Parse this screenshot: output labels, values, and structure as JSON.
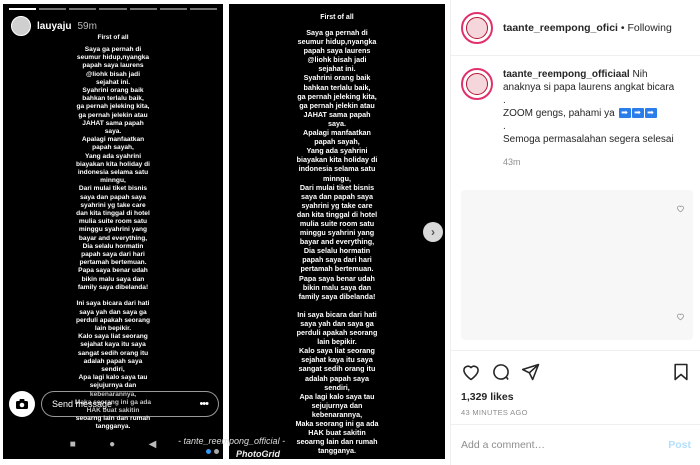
{
  "story_left": {
    "username": "lauyaju",
    "time": "59m",
    "title": "First of all",
    "text": "Saya ga pernah di\nseumur hidup,nyangka\npapah saya laurens\n@liohk bisah jadi\nsejahat ini.\nSyahrini orang baik\nbahkan terlalu baik,\nga pernah jeleking kita,\nga pernah jelekin atau\nJAHAT sama papah\nsaya.\nApalagi manfaatkan\npapah sayah,\nYang ada syahrini\nbiayakan kita holiday di\nindonesia selama satu\nminngu,\nDari mulai tiket bisnis\nsaya dan papah saya\nsyahrini yg take care\ndan kita tinggal di hotel\nmulia suite room satu\nminggu syahrini yang\nbayar and everything,\nDia selalu hormatin\npapah saya dari hari\npertamah bertemuan.\nPapa saya benar udah\nbikin malu saya dan\nfamily saya dibelanda!\n\nIni saya bicara dari hati\nsaya yah dan saya ga\nperduli apakah seorang\nlain bepikir.\nKalo saya liat seorang\nsejahat kaya itu saya\nsangat sedih orang itu\nadalah papah saya\nsendiri,\nApa lagi kalo saya tau\nsejujurnya dan\nkebenarannya,\nMaka seorang ini ga ada\nHAK buat sakitin\nseoarng lain dan rumah\ntangganya.",
    "send_placeholder": "Send message",
    "menu_dots": "•••",
    "nav_square": "■",
    "nav_circle": "●",
    "nav_back": "◀"
  },
  "story_right": {
    "title": "First of all",
    "text": "Saya ga pernah di\nseumur hidup,nyangka\npapah saya laurens\n@liohk bisah jadi\nsejahat ini.\nSyahrini orang baik\nbahkan terlalu baik,\nga pernah jeleking kita,\nga pernah jelekin atau\nJAHAT sama papah\nsaya.\nApalagi manfaatkan\npapah sayah,\nYang ada syahrini\nbiayakan kita holiday di\nindonesia selama satu\nminngu,\nDari mulai tiket bisnis\nsaya dan papah saya\nsyahrini yg take care\ndan kita tinggal di hotel\nmulia suite room satu\nminggu syahrini yang\nbayar and everything,\nDia selalu hormatin\npapah saya dari hari\npertamah bertemuan.\nPapa saya benar udah\nbikin malu saya dan\nfamily saya dibelanda!\n\nIni saya bicara dari hati\nsaya yah dan saya ga\nperduli apakah seorang\nlain bepikir.\nKalo saya liat seorang\nsejahat kaya itu saya\nsangat sedih orang itu\nadalah papah saya\nsendiri,\nApa lagi kalo saya tau\nsejujurnya dan\nkebenarannya,\nMaka seorang ini ga ada\nHAK buat sakitin\nseoarng lain dan rumah\ntangganya."
  },
  "watermark": "- tante_reempong_official -",
  "photogrid": "PhotoGrid",
  "next_arrow": "›",
  "header": {
    "username": "taante_reempong_ofici",
    "separator": " • ",
    "follow_label": "Following"
  },
  "caption": {
    "username": "taante_reempong_officiaal",
    "line1": "Nih",
    "line2": "anaknya si papa laurens angkat bicara",
    "dot1": ".",
    "line3": "ZOOM gengs, pahami ya",
    "arrows": [
      "➡",
      "➡",
      "➡"
    ],
    "dot2": ".",
    "line4": "Semoga permasalahan segera selesai",
    "time": "43m"
  },
  "likes": "1,329 likes",
  "timestamp": "43 MINUTES AGO",
  "add_comment_placeholder": "Add a comment…",
  "post_label": "Post",
  "colors": {
    "accent": "#3897f0",
    "post_disabled": "#b2dffc"
  }
}
